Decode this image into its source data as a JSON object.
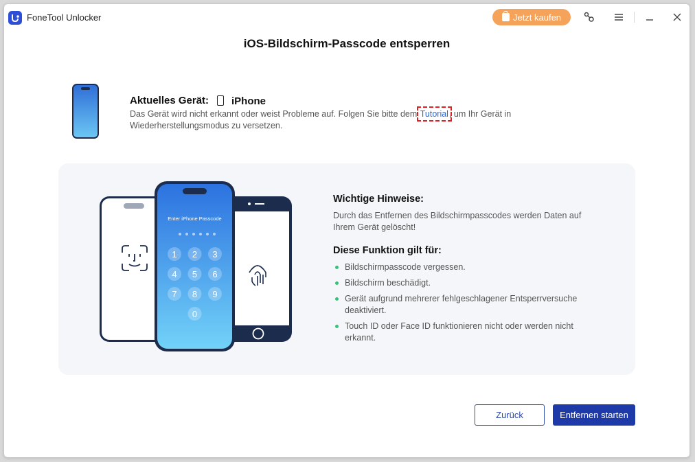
{
  "window": {
    "app_title": "FoneTool Unlocker",
    "buy_label": "Jetzt kaufen"
  },
  "page": {
    "title": "iOS-Bildschirm-Passcode entsperren"
  },
  "device": {
    "label": "Aktuelles Gerät:",
    "name": "iPhone",
    "message_before": "Das Gerät wird nicht erkannt oder weist Probleme auf. Folgen Sie bitte dem ",
    "tutorial_link": "Tutorial",
    "message_after": ", um Ihr Gerät in Wiederherstellungsmodus zu versetzen."
  },
  "illustration": {
    "passcode_prompt": "Enter iPhone Passcode",
    "keys": [
      "1",
      "2",
      "3",
      "4",
      "5",
      "6",
      "7",
      "8",
      "9",
      "0"
    ]
  },
  "notes": {
    "important_title": "Wichtige Hinweise:",
    "important_text": "Durch das Entfernen des Bildschirmpasscodes werden Daten auf Ihrem Gerät gelöscht!",
    "applies_title": "Diese Funktion gilt für:",
    "items": [
      "Bildschirmpasscode vergessen.",
      "Bildschirm beschädigt.",
      "Gerät aufgrund mehrerer fehlgeschlagener Entsperrversuche deaktiviert.",
      "Touch ID oder Face ID funktionieren nicht oder werden nicht erkannt."
    ]
  },
  "footer": {
    "back_label": "Zurück",
    "start_label": "Entfernen starten"
  },
  "colors": {
    "accent": "#1d3aa8",
    "buy": "#f5a35a",
    "bullet": "#3cbf7a",
    "link": "#2a6ad8"
  }
}
